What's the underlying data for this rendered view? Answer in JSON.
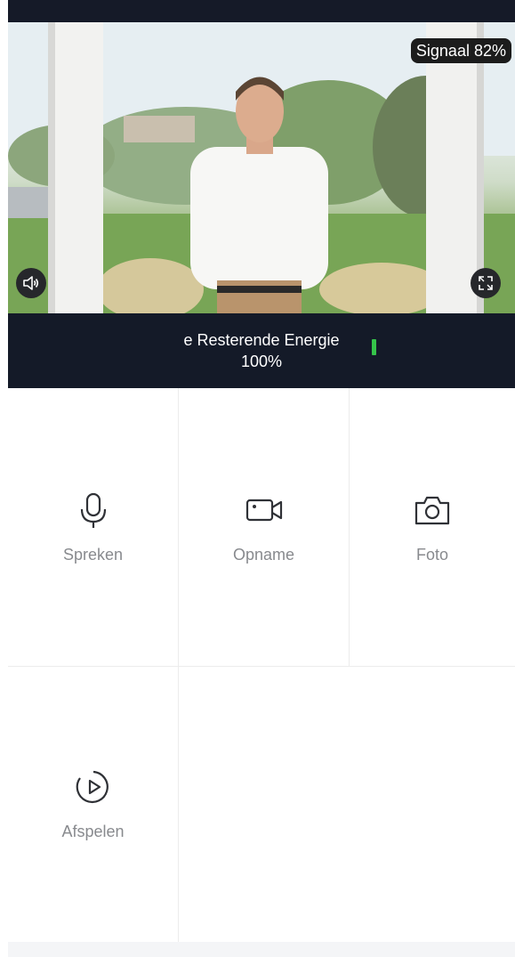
{
  "video": {
    "signal_label": "Signaal",
    "signal_value": "82%"
  },
  "energy": {
    "label": "e Resterende Energie",
    "value": "100%"
  },
  "actions": [
    {
      "label": "Spreken",
      "icon": "microphone-icon"
    },
    {
      "label": "Opname",
      "icon": "video-camera-icon"
    },
    {
      "label": "Foto",
      "icon": "camera-icon"
    },
    {
      "label": "Afspelen",
      "icon": "playback-icon"
    }
  ],
  "colors": {
    "dark_bar": "#141a28",
    "battery": "#35c44a",
    "label_gray": "#888a8e"
  }
}
